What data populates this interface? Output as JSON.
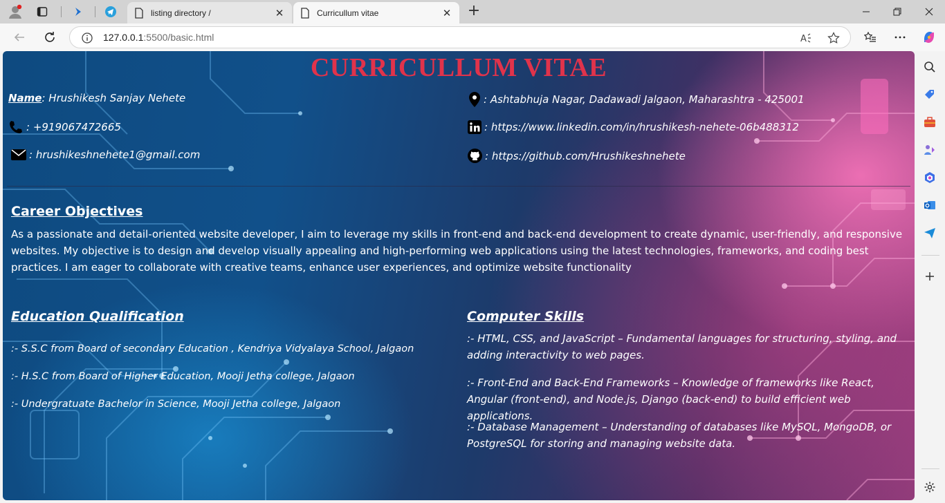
{
  "browser": {
    "tabs": [
      {
        "title": "listing directory /",
        "active": false
      },
      {
        "title": "Curricullum vitae",
        "active": true
      }
    ],
    "address": {
      "host": "127.0.0.1",
      "rest": ":5500/basic.html"
    }
  },
  "cv": {
    "title": "CURRICULLUM VITAE",
    "name_label": "Name",
    "name_value": ": Hrushikesh Sanjay Nehete",
    "phone": ": +919067472665",
    "email": ": hrushikeshnehete1@gmail.com",
    "address": ": Ashtabhuja Nagar, Dadawadi Jalgaon, Maharashtra - 425001",
    "linkedin": ": https://www.linkedin.com/in/hrushikesh-nehete-06b488312",
    "github": ": https://github.com/Hrushikeshnehete",
    "career": {
      "heading": "Career Objectives",
      "text": "As a passionate and detail-oriented website developer, I aim to leverage my skills in front-end and back-end development to create dynamic, user-friendly, and responsive websites. My objective is to design and develop visually appealing and high-performing web applications using the latest technologies, frameworks, and coding best practices. I am eager to collaborate with creative teams, enhance user experiences, and optimize website functionality"
    },
    "education": {
      "heading": "Education Qualification",
      "items": [
        ":- S.S.C from Board of secondary Education , Kendriya Vidyalaya School, Jalgaon",
        ":- H.S.C from Board of Higher Education, Mooji Jetha college, Jalgaon",
        ":- Undergratuate Bachelor in Science, Mooji Jetha college, Jalgaon"
      ]
    },
    "skills": {
      "heading": "Computer Skills",
      "items": [
        ":- HTML, CSS, and JavaScript – Fundamental languages for structuring, styling, and adding interactivity to web pages.",
        ":- Front-End and Back-End Frameworks – Knowledge of frameworks like React, Angular (front-end), and Node.js, Django (back-end) to build efficient web applications.",
        ":- Database Management – Understanding of databases like MySQL, MongoDB, or PostgreSQL for storing and managing website data."
      ]
    }
  },
  "colors": {
    "title_red": "#e0334b",
    "bg_blue": "#11508a",
    "bg_pink": "#ff78be"
  }
}
